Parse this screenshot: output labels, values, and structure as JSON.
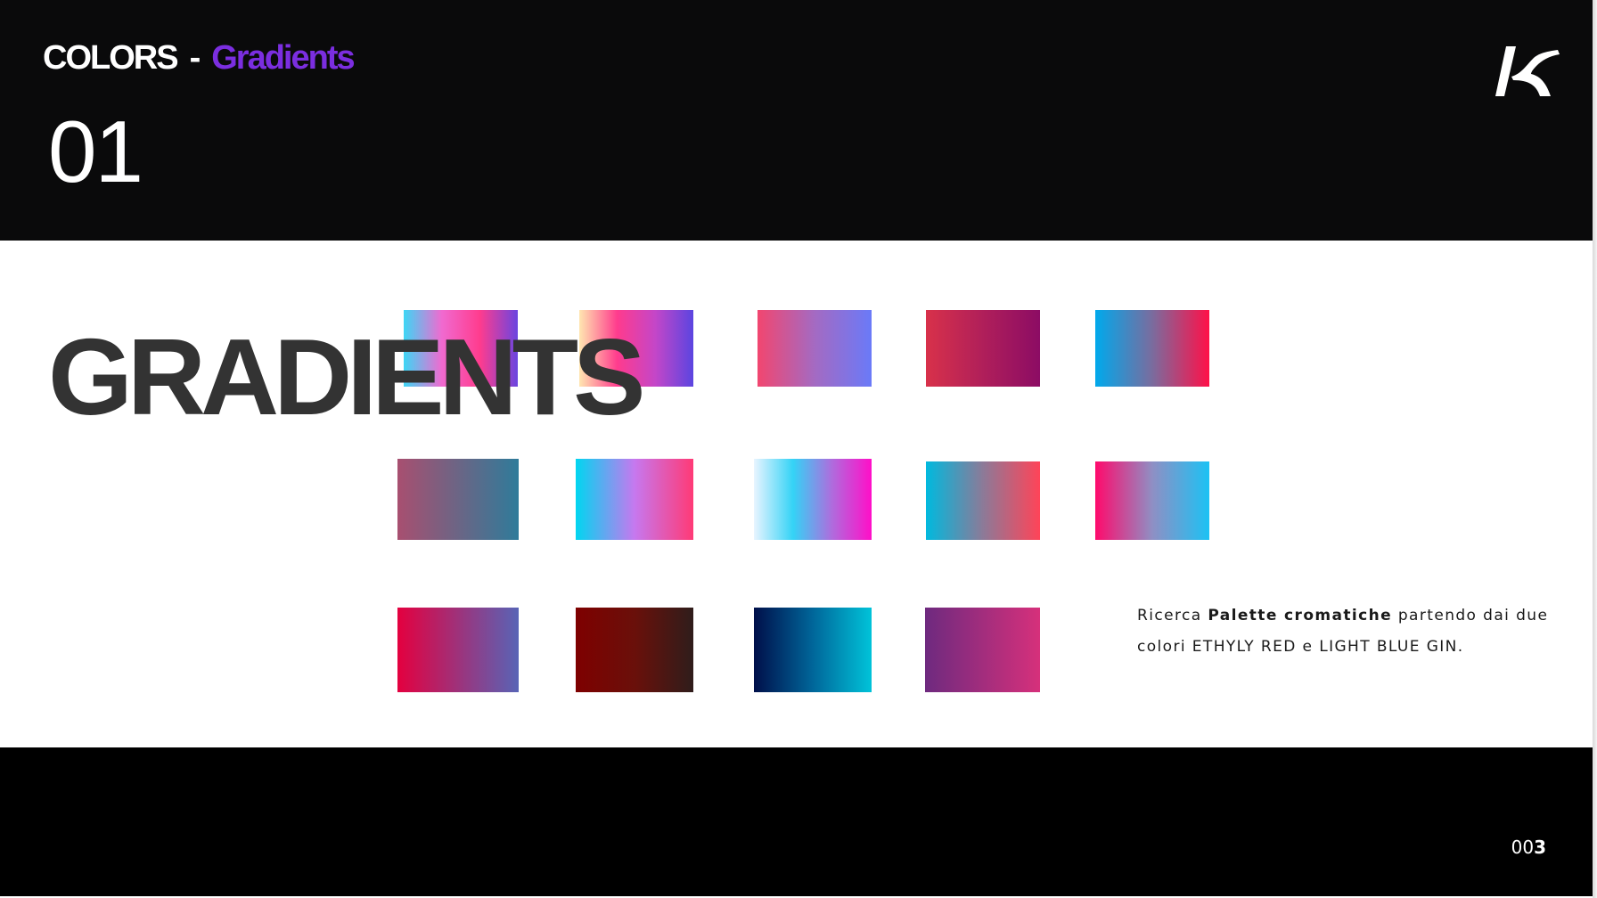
{
  "header": {
    "title_main": "COLORS",
    "title_separator": "-",
    "title_accent": "Gradients",
    "accent_color": "#7b2ee0",
    "section_number": "01",
    "logo_icon": "brand-logo-icon"
  },
  "main": {
    "big_title": "GRADIENTS",
    "description": {
      "pre": "Ricerca ",
      "bold": "Palette cromatiche",
      "post": " partendo dai due colori ETHYLY RED e LIGHT BLUE GIN."
    },
    "swatches": [
      {
        "id": "r1c1",
        "stops": [
          "#3dd6f5",
          "#f06ad0",
          "#ff3c8e",
          "#6a45e0"
        ]
      },
      {
        "id": "r1c2",
        "stops": [
          "#ffe6b0",
          "#ff3b8d",
          "#c446c8",
          "#5b45e0"
        ]
      },
      {
        "id": "r1c3",
        "stops": [
          "#f2466f",
          "#a46ac2",
          "#6a7af8"
        ]
      },
      {
        "id": "r1c4",
        "stops": [
          "#d8314a",
          "#b01f5a",
          "#8c0c64"
        ]
      },
      {
        "id": "r1c5",
        "stops": [
          "#00a9ec",
          "#7a6c9e",
          "#ff1048"
        ]
      },
      {
        "id": "r2c1",
        "stops": [
          "#a84f70",
          "#2f7b9a"
        ]
      },
      {
        "id": "r2c2",
        "stops": [
          "#00d6f0",
          "#c678ef",
          "#ff3a76"
        ]
      },
      {
        "id": "r2c3",
        "stops": [
          "#e8f4ff",
          "#34d3f6",
          "#b06bdd",
          "#ff0fc8"
        ]
      },
      {
        "id": "r2c4",
        "stops": [
          "#00b9de",
          "#8c7a98",
          "#ff4458"
        ]
      },
      {
        "id": "r2c5",
        "stops": [
          "#ff0a6c",
          "#8f8fc4",
          "#1cc2f4"
        ]
      },
      {
        "id": "r3c1",
        "stops": [
          "#e4003f",
          "#5864b6"
        ]
      },
      {
        "id": "r3c2",
        "stops": [
          "#7e0000",
          "#6a100a",
          "#2f1d1b"
        ]
      },
      {
        "id": "r3c3",
        "stops": [
          "#000f4a",
          "#00669a",
          "#00c3d9"
        ]
      },
      {
        "id": "r3c4",
        "stops": [
          "#6e2a7f",
          "#d6307b"
        ]
      }
    ]
  },
  "footer": {
    "page_prefix": "00",
    "page_bold": "3"
  }
}
